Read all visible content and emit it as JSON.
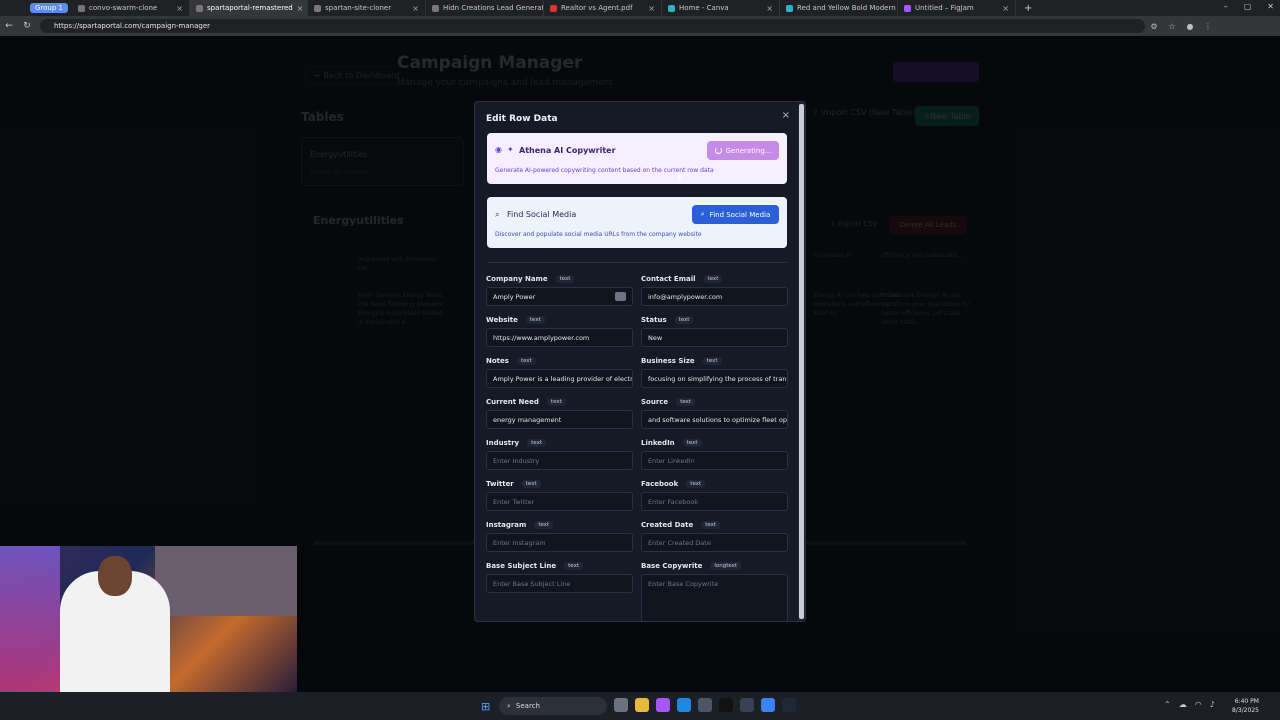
{
  "browser": {
    "tab_group": "Group 1",
    "tabs": [
      {
        "title": "convo-swarm-clone",
        "active": false
      },
      {
        "title": "spartaportal-remastered",
        "active": true
      },
      {
        "title": "spartan-site-cloner",
        "active": false
      },
      {
        "title": "Hidn Creations Lead Generator -",
        "active": false
      },
      {
        "title": "Realtor vs Agent.pdf",
        "active": false
      },
      {
        "title": "Home - Canva",
        "active": false
      },
      {
        "title": "Red and Yellow Bold Modern You",
        "active": false
      },
      {
        "title": "Untitled – FigJam",
        "active": false
      }
    ],
    "url": "https://spartaportal.com/campaign-manager"
  },
  "background_page": {
    "back_label": "Back to Dashboard",
    "title": "Campaign Manager",
    "subtitle": "Manage your campaigns and lead management",
    "tables_heading": "Tables",
    "import_label": "Import CSV (New Table)",
    "new_table_label": "New Table",
    "table_card_title": "Energyutilities",
    "table_card_sub": "1 rows, 30 columns",
    "section_title": "Energyutilities",
    "export_label": "Export CSV",
    "delete_label": "Delete All Leads",
    "cells": [
      "impressed with Schneider Ele...",
      "Hello Siemens Energy Team, I've been following Siemens Energy's remarkable strides in sustainable e...",
      "to lonsors AI",
      "efficiency and sustainabil...",
      "Energy AI can help automate operations and efficiency. Keen to",
      "Hi Siemens Energy! AI can transform your operations for better efficiency. Let's talk about cutti..."
    ]
  },
  "modal": {
    "title": "Edit Row Data",
    "close_icon": "×",
    "ai_writer": {
      "title": "Athena AI Copywriter",
      "description": "Generate AI-powered copywriting content based on the current row data",
      "button_label": "Generating..."
    },
    "social": {
      "title": "Find Social Media",
      "description": "Discover and populate social media URLs from the company website",
      "button_label": "Find Social Media"
    },
    "fields": [
      {
        "label": "Company Name",
        "type": "text",
        "value": "Amply Power",
        "placeholder": ""
      },
      {
        "label": "Contact Email",
        "type": "text",
        "value": "info@amplypower.com",
        "placeholder": ""
      },
      {
        "label": "Website",
        "type": "text",
        "value": "https://www.amplypower.com",
        "placeholder": ""
      },
      {
        "label": "Status",
        "type": "text",
        "value": "New",
        "placeholder": ""
      },
      {
        "label": "Notes",
        "type": "text",
        "value": "Amply Power is a leading provider of electri",
        "placeholder": ""
      },
      {
        "label": "Business Size",
        "type": "text",
        "value": "focusing on simplifying the process of trans",
        "placeholder": ""
      },
      {
        "label": "Current Need",
        "type": "text",
        "value": "energy management",
        "placeholder": ""
      },
      {
        "label": "Source",
        "type": "text",
        "value": "and software solutions to optimize fleet ope",
        "placeholder": ""
      },
      {
        "label": "Industry",
        "type": "text",
        "value": "",
        "placeholder": "Enter Industry"
      },
      {
        "label": "LinkedIn",
        "type": "text",
        "value": "",
        "placeholder": "Enter LinkedIn"
      },
      {
        "label": "Twitter",
        "type": "text",
        "value": "",
        "placeholder": "Enter Twitter"
      },
      {
        "label": "Facebook",
        "type": "text",
        "value": "",
        "placeholder": "Enter Facebook"
      },
      {
        "label": "Instagram",
        "type": "text",
        "value": "",
        "placeholder": "Enter Instagram"
      },
      {
        "label": "Created Date",
        "type": "text",
        "value": "",
        "placeholder": "Enter Created Date"
      },
      {
        "label": "Base Subject Line",
        "type": "text",
        "value": "",
        "placeholder": "Enter Base Subject Line"
      },
      {
        "label": "Base Copywrite",
        "type": "longtext",
        "value": "",
        "placeholder": "Enter Base Copywrite"
      }
    ]
  },
  "taskbar": {
    "search_label": "Search",
    "time": "6:40 PM",
    "date": "8/3/2025"
  },
  "colors": {
    "ai_button": "#c68be8",
    "social_button": "#2b5fd9",
    "modal_bg": "#141a26"
  }
}
